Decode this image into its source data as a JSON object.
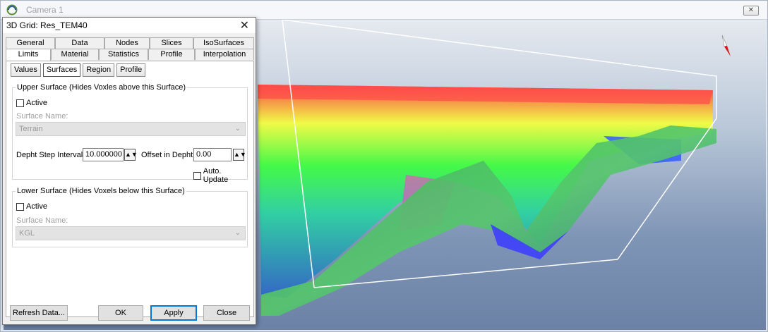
{
  "camera_window": {
    "title": "Camera 1",
    "close_glyph": "✕"
  },
  "dialog": {
    "title": "3D Grid: Res_TEM40",
    "close_glyph": "✕",
    "tabs_row1": [
      "General",
      "Data",
      "Nodes",
      "Slices",
      "IsoSurfaces"
    ],
    "tabs_row2": [
      "Limits",
      "Material",
      "Statistics",
      "Profile",
      "Interpolation"
    ],
    "subtabs": [
      "Values",
      "Surfaces",
      "Region",
      "Profile"
    ],
    "upper": {
      "legend": "Upper Surface (Hides Voxles above this Surface)",
      "active_label": "Active",
      "surface_name_label": "Surface Name:",
      "surface_value": "Terrain",
      "step_label": "Depht Step Interval",
      "step_value": "10.000000",
      "offset_label": "Offset in Depht",
      "offset_value": "0.00",
      "auto_update_label": "Auto. Update"
    },
    "lower": {
      "legend": "Lower Surface (Hides Voxels below this Surface)",
      "active_label": "Active",
      "surface_name_label": "Surface Name:",
      "surface_value": "KGL"
    },
    "buttons": {
      "refresh": "Refresh Data...",
      "ok": "OK",
      "apply": "Apply",
      "close": "Close"
    }
  }
}
